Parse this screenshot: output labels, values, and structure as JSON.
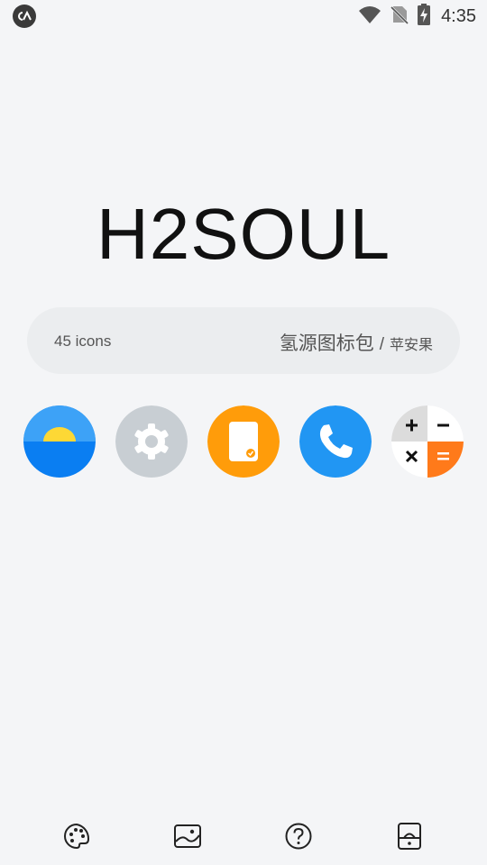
{
  "status_bar": {
    "time": "4:35",
    "icons": [
      "app-notification-icon",
      "wifi-icon",
      "no-sim-icon",
      "battery-charging-icon"
    ]
  },
  "header": {
    "title": "H2SOUL"
  },
  "info": {
    "icon_count": "45 icons",
    "pack_title": "氢源图标包",
    "separator": "/",
    "pack_subtitle": "苹安果"
  },
  "preview_icons": [
    {
      "name": "weather-icon",
      "color": "#1e88f0"
    },
    {
      "name": "settings-icon",
      "color": "#c8ced3"
    },
    {
      "name": "tablet-icon",
      "color": "#ff9800"
    },
    {
      "name": "phone-icon",
      "color": "#2196f3"
    },
    {
      "name": "calculator-icon",
      "color": "#ff7a1a"
    }
  ],
  "bottom_nav": {
    "items": [
      "palette-icon",
      "wallpaper-icon",
      "help-icon",
      "apply-icon"
    ]
  }
}
